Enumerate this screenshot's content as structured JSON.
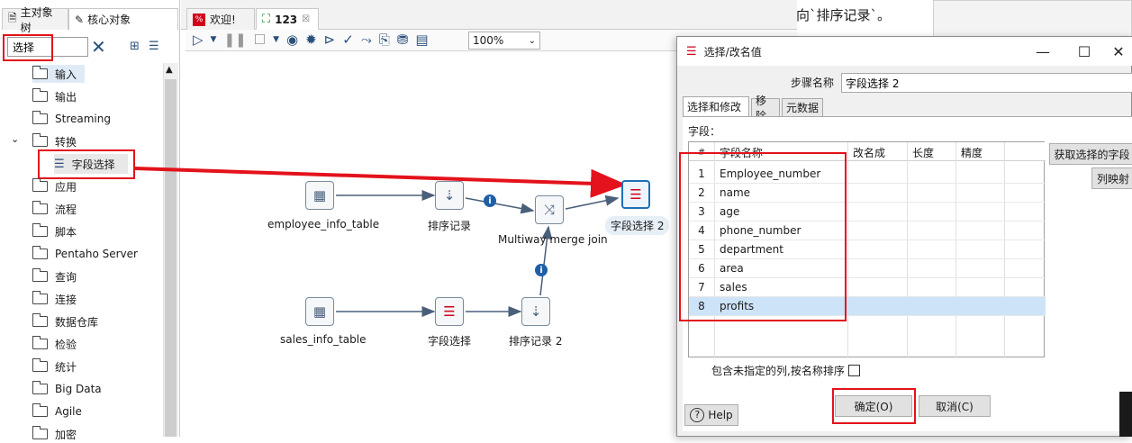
{
  "left_panel": {
    "tabs": [
      "主对象树",
      "核心对象"
    ],
    "search_value": "选择",
    "tree": [
      {
        "label": "输入"
      },
      {
        "label": "输出"
      },
      {
        "label": "Streaming"
      },
      {
        "label": "转换",
        "expanded": true
      },
      {
        "label": "字段选择",
        "child": true
      },
      {
        "label": "应用"
      },
      {
        "label": "流程"
      },
      {
        "label": "脚本"
      },
      {
        "label": "Pentaho Server"
      },
      {
        "label": "查询"
      },
      {
        "label": "连接"
      },
      {
        "label": "数据仓库"
      },
      {
        "label": "检验"
      },
      {
        "label": "统计"
      },
      {
        "label": "Big Data"
      },
      {
        "label": "Agile"
      },
      {
        "label": "加密"
      }
    ]
  },
  "editor": {
    "tabs": [
      "欢迎!",
      "123"
    ],
    "zoom": "100%",
    "nodes": {
      "employee_info_table": "employee_info_table",
      "sort1": "排序记录",
      "merge": "Multiway merge join",
      "select2": "字段选择 2",
      "sales_info_table": "sales_info_table",
      "select1": "字段选择",
      "sort2": "排序记录 2"
    }
  },
  "background_doc": {
    "text": "向`排序记录`。"
  },
  "dialog": {
    "title": "选择/改名值",
    "step_name_label": "步骤名称",
    "step_name_value": "字段选择 2",
    "tabs": [
      "选择和修改",
      "移除",
      "元数据"
    ],
    "fields_label": "字段：",
    "columns": [
      "#",
      "字段名称",
      "改名成",
      "长度",
      "精度"
    ],
    "rows": [
      {
        "n": "1",
        "name": "Employee_number"
      },
      {
        "n": "2",
        "name": "name"
      },
      {
        "n": "3",
        "name": "age"
      },
      {
        "n": "4",
        "name": "phone_number"
      },
      {
        "n": "5",
        "name": "department"
      },
      {
        "n": "6",
        "name": "area"
      },
      {
        "n": "7",
        "name": "sales"
      },
      {
        "n": "8",
        "name": "profits"
      }
    ],
    "get_fields_button": "获取选择的字段",
    "mapping_button": "列映射",
    "include_unspecified": "包含未指定的列,按名称排序",
    "help_button": "Help",
    "ok_button": "确定(O)",
    "cancel_button": "取消(C)"
  },
  "colors": {
    "highlight_red": "#e3121b",
    "selected_row": "#cde3f7",
    "accent_blue": "#1f6fb5"
  }
}
